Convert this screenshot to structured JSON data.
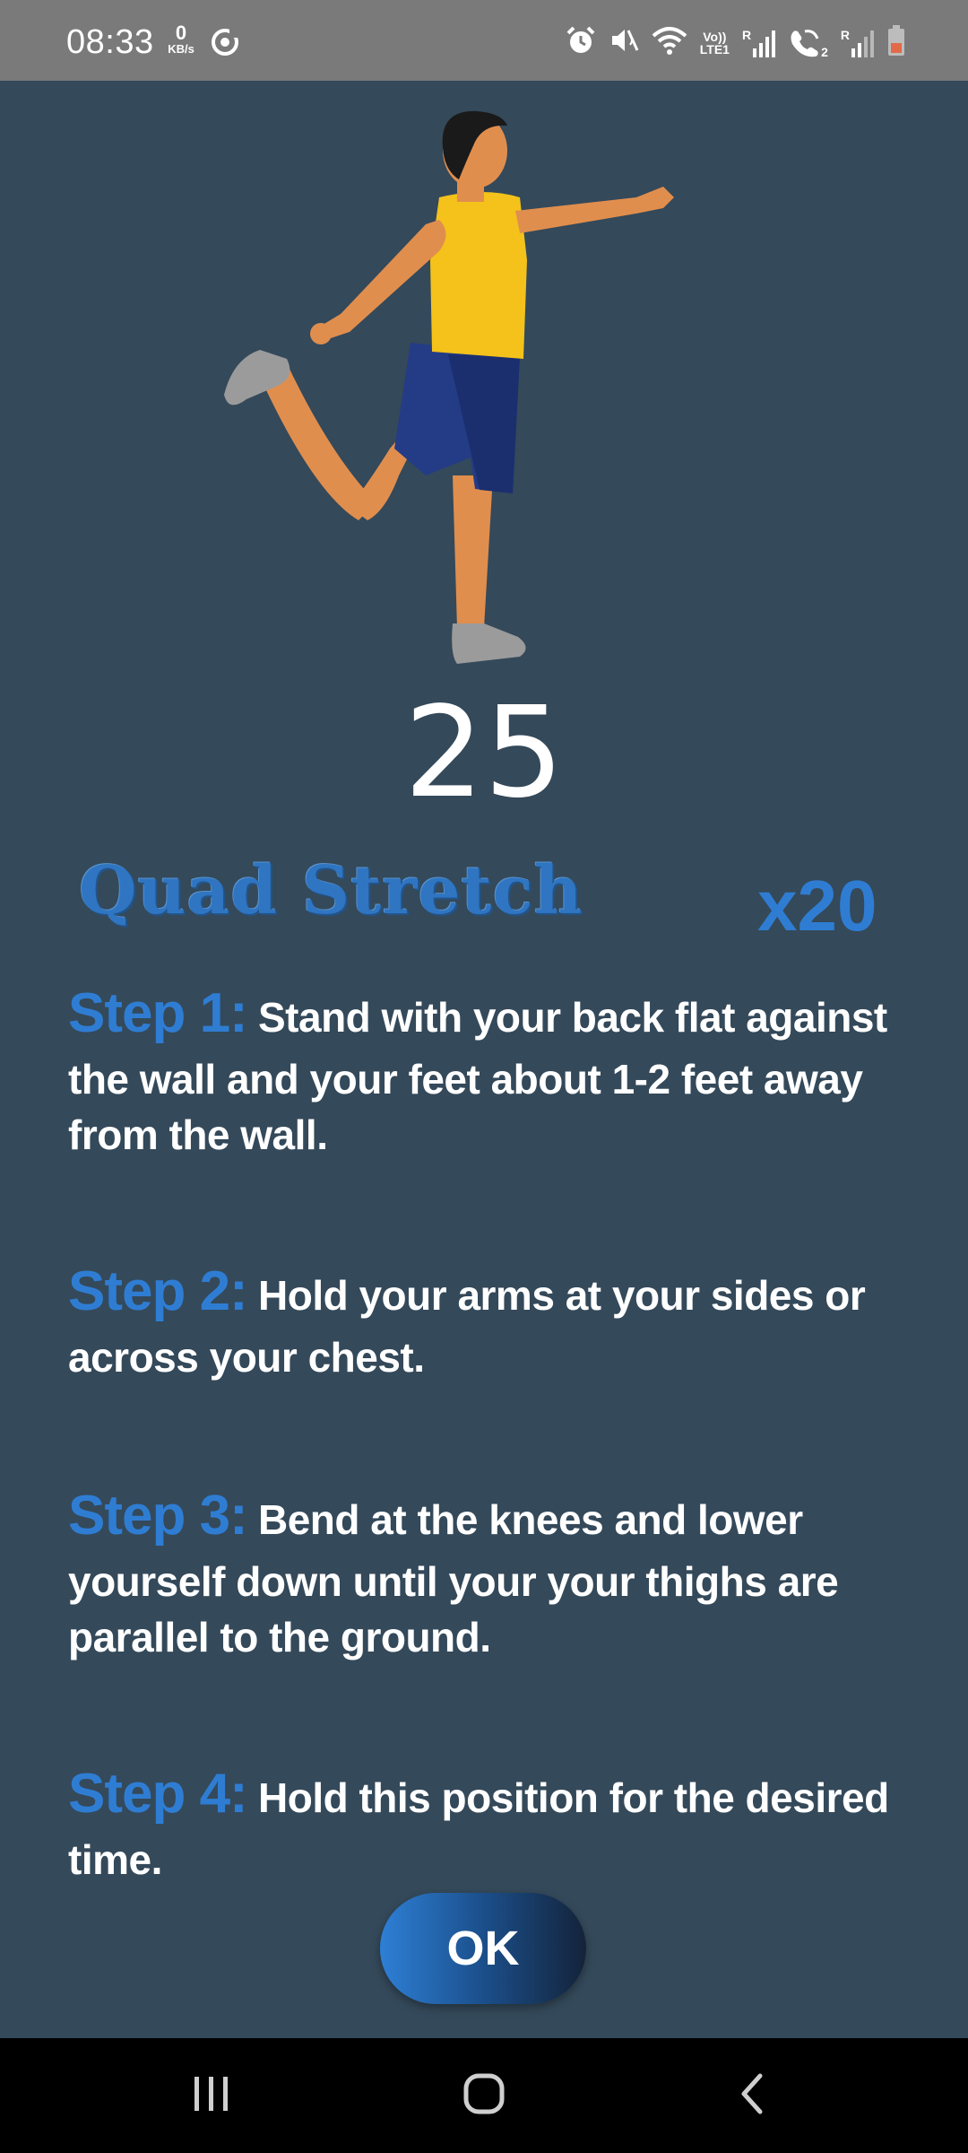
{
  "status_bar": {
    "time": "08:33",
    "net_speed_value": "0",
    "net_speed_unit": "KB/s",
    "volte_label": "Vo))",
    "lte_label": "LTE1",
    "sim1_label": "R",
    "sim2_label": "R",
    "sim2_index": "2"
  },
  "exercise": {
    "timer": "25",
    "title": "Quad Stretch",
    "reps": "x20",
    "steps": [
      {
        "label": "Step 1:",
        "text": "Stand with your back flat against the wall and your feet about 1-2 feet away from the wall."
      },
      {
        "label": "Step 2:",
        "text": "Hold your arms at your sides or across your chest."
      },
      {
        "label": "Step 3:",
        "text": "Bend at the knees and lower yourself down until your your thighs are parallel to the ground."
      },
      {
        "label": "Step 4:",
        "text": "Hold this position for the desired time."
      }
    ]
  },
  "actions": {
    "ok_label": "OK"
  },
  "colors": {
    "background": "#34495a",
    "accent_blue": "#2f7dd3",
    "status_bar": "#7a7a7a",
    "nav_bar": "#000000"
  },
  "icons": {
    "status_left": [
      "sync-icon"
    ],
    "status_right": [
      "alarm-icon",
      "mute-icon",
      "wifi-icon",
      "signal-icon",
      "wifi-calling-icon",
      "signal-icon",
      "battery-icon"
    ],
    "nav": [
      "recent-apps-icon",
      "home-icon",
      "back-icon"
    ]
  }
}
